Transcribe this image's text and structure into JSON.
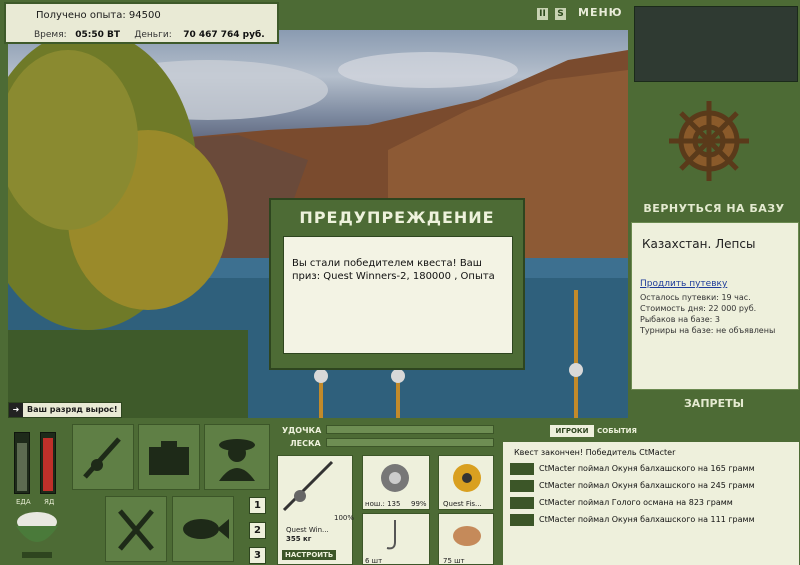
{
  "stats": {
    "xp_label": "Получено опыта: 94500",
    "time_label": "Время:",
    "time_value": "05:50 ВТ",
    "money_label": "Деньги:",
    "money_value": "70 467 764 руб."
  },
  "top_icons": {
    "pause": "II",
    "sound": "S",
    "menu": "МЕНЮ"
  },
  "right_panel": {
    "return_label": "ВЕРНУТЬСЯ НА БАЗУ",
    "location_title": "Казахстан. Лепсы",
    "extend_link": "Продлить путевку",
    "lines": [
      "Осталось путевки: 19 час.",
      "Стоимость дня: 22 000 руб.",
      "Рыбаков на базе: 3",
      "Турниры на базе: не объявлены"
    ],
    "bans_label": "ЗАПРЕТЫ"
  },
  "dialog": {
    "title": "ПРЕДУПРЕЖДЕНИЕ",
    "message": "Вы стали победителем квеста! Ваш приз: Quest Winners-2, 180000 , Опыта"
  },
  "badge": {
    "text": "Ваш разряд вырос!"
  },
  "meters": {
    "food_label": "ЕДА",
    "poison_label": "ЯД",
    "food_level": 0.85,
    "poison_level": 0.95
  },
  "page_numbers": [
    "1",
    "2",
    "3"
  ],
  "gear": {
    "hook_label": "УДОЧКА",
    "line_label": "ЛЕСКА",
    "rod_name": "Quest Win...",
    "rod_weight": "355 кг",
    "percent": "100%",
    "setup_button": "НАСТРОИТЬ",
    "reel_caption": "нош.: 135",
    "reel_percent": "99%",
    "line_caption": "Quest Fis...",
    "hook_count": "6 шт",
    "bait_count": "75 шт"
  },
  "events": {
    "tab_players": "ИГРОКИ",
    "tab_events": "СОБЫТИЯ",
    "quest_line": "Квест закончен! Победитель CtMacter",
    "items": [
      "CtMacter поймал Окуня балхашского на 165 грамм",
      "CtMacter поймал Окуня балхашского на 245 грамм",
      "CtMacter поймал Голого османа на 823 грамм",
      "CtMacter поймал Окуня балхашского на 111 грамм"
    ]
  }
}
